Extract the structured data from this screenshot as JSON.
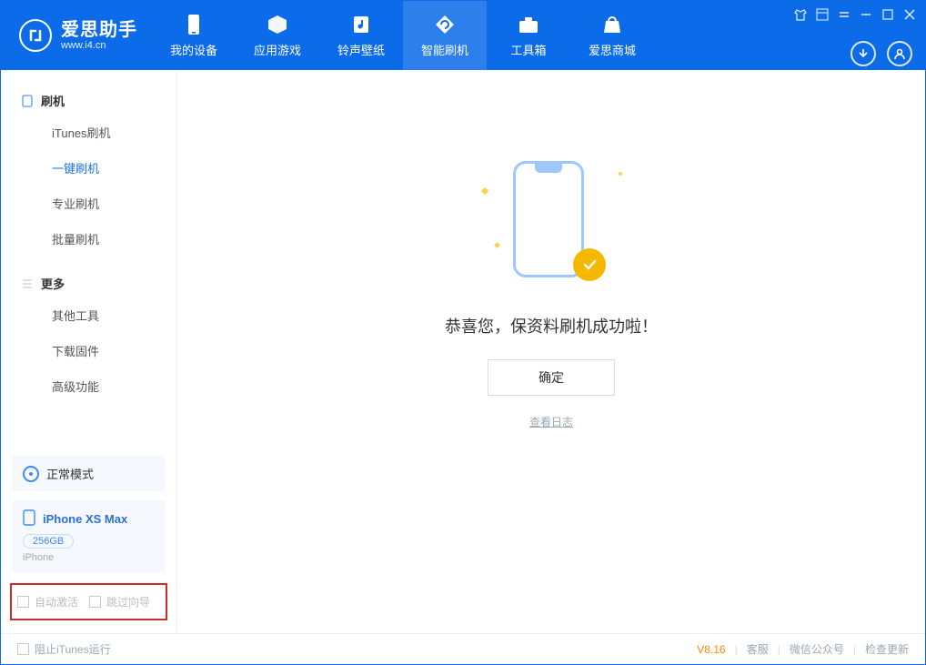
{
  "app": {
    "title": "爱思助手",
    "subtitle": "www.i4.cn"
  },
  "titlebar_icons": [
    "shirt-icon",
    "menu-icon",
    "equals-icon",
    "minimize-icon",
    "maximize-icon",
    "close-icon"
  ],
  "nav": [
    {
      "label": "我的设备",
      "icon": "device-icon",
      "active": false
    },
    {
      "label": "应用游戏",
      "icon": "cube-icon",
      "active": false
    },
    {
      "label": "铃声壁纸",
      "icon": "music-icon",
      "active": false
    },
    {
      "label": "智能刷机",
      "icon": "refresh-icon",
      "active": true
    },
    {
      "label": "工具箱",
      "icon": "toolbox-icon",
      "active": false
    },
    {
      "label": "爱思商城",
      "icon": "bag-icon",
      "active": false
    }
  ],
  "sidebar": {
    "groups": [
      {
        "head": "刷机",
        "icon": "phone-icon",
        "items": [
          {
            "label": "iTunes刷机",
            "active": false
          },
          {
            "label": "一键刷机",
            "active": true
          },
          {
            "label": "专业刷机",
            "active": false
          },
          {
            "label": "批量刷机",
            "active": false
          }
        ]
      },
      {
        "head": "更多",
        "icon": "list-icon",
        "items": [
          {
            "label": "其他工具",
            "active": false
          },
          {
            "label": "下载固件",
            "active": false
          },
          {
            "label": "高级功能",
            "active": false
          }
        ]
      }
    ],
    "mode": {
      "label": "正常模式"
    },
    "device": {
      "name": "iPhone XS Max",
      "capacity": "256GB",
      "type": "iPhone"
    },
    "options": {
      "auto_activate": "自动激活",
      "skip_guide": "跳过向导"
    }
  },
  "main": {
    "message": "恭喜您，保资料刷机成功啦！",
    "ok_label": "确定",
    "log_label": "查看日志"
  },
  "footer": {
    "block_itunes": "阻止iTunes运行",
    "version": "V8.16",
    "links": [
      "客服",
      "微信公众号",
      "检查更新"
    ]
  }
}
